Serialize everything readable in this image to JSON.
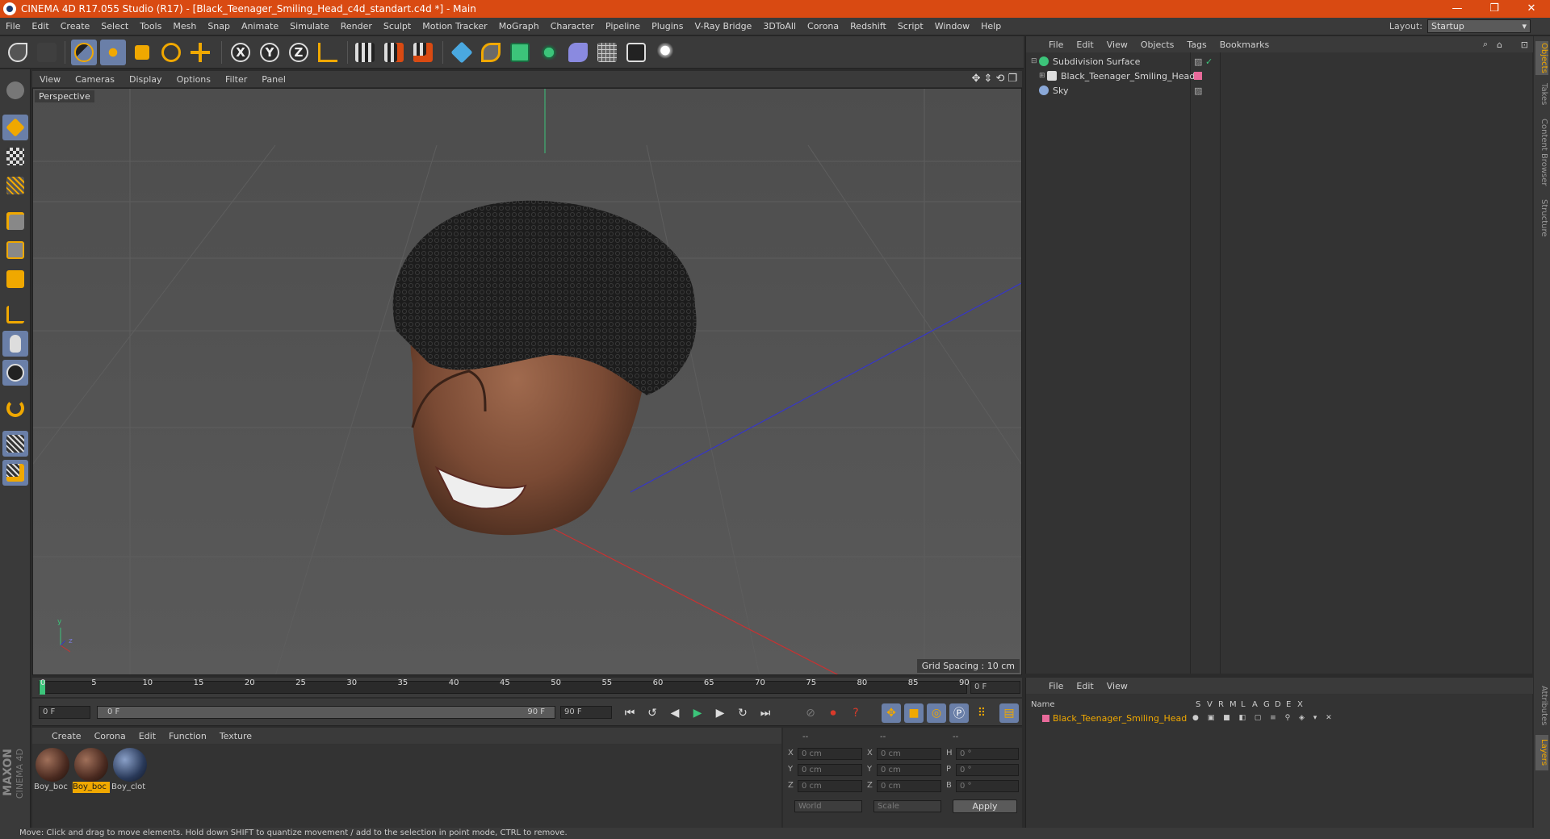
{
  "window": {
    "title": "CINEMA 4D R17.055 Studio (R17) - [Black_Teenager_Smiling_Head_c4d_standart.c4d *] - Main",
    "minimize": "—",
    "restore": "❐",
    "close": "✕"
  },
  "menubar": {
    "items": [
      "File",
      "Edit",
      "Create",
      "Select",
      "Tools",
      "Mesh",
      "Snap",
      "Animate",
      "Simulate",
      "Render",
      "Sculpt",
      "Motion Tracker",
      "MoGraph",
      "Character",
      "Pipeline",
      "Plugins",
      "V-Ray Bridge",
      "3DToAll",
      "Corona",
      "Redshift",
      "Script",
      "Window",
      "Help"
    ],
    "layout_label": "Layout:",
    "layout_value": "Startup"
  },
  "toolbar": {
    "axis_x": "X",
    "axis_y": "Y",
    "axis_z": "Z",
    "colors": {
      "active": "#6a7fa8",
      "orange": "#f0a800",
      "blue": "#4aa8e0",
      "green": "#3cc47a"
    }
  },
  "viewport": {
    "menu": [
      "View",
      "Cameras",
      "Display",
      "Options",
      "Filter",
      "Panel"
    ],
    "label": "Perspective",
    "grid_spacing": "Grid Spacing : 10 cm",
    "axis_y": "y",
    "axis_z": "z"
  },
  "timeline": {
    "ticks": [
      "0",
      "5",
      "10",
      "15",
      "20",
      "25",
      "30",
      "35",
      "40",
      "45",
      "50",
      "55",
      "60",
      "65",
      "70",
      "75",
      "80",
      "85",
      "90"
    ],
    "current_frame": "0 F",
    "start_field": "0 F",
    "range_start": "0 F",
    "range_end": "90 F",
    "end_field": "90 F"
  },
  "material_manager": {
    "menu": [
      "Create",
      "Corona",
      "Edit",
      "Function",
      "Texture"
    ],
    "materials": [
      {
        "label": "Boy_boc",
        "selected": false
      },
      {
        "label": "Boy_boc",
        "selected": true
      },
      {
        "label": "Boy_clot",
        "selected": false
      }
    ]
  },
  "coordinates": {
    "headers": [
      "--",
      "--",
      "--"
    ],
    "rows": [
      {
        "a": "X",
        "av": "0 cm",
        "b": "X",
        "bv": "0 cm",
        "c": "H",
        "cv": "0 °"
      },
      {
        "a": "Y",
        "av": "0 cm",
        "b": "Y",
        "bv": "0 cm",
        "c": "P",
        "cv": "0 °"
      },
      {
        "a": "Z",
        "av": "0 cm",
        "b": "Z",
        "bv": "0 cm",
        "c": "B",
        "cv": "0 °"
      }
    ],
    "mode1": "World",
    "mode2": "Scale",
    "apply": "Apply"
  },
  "object_manager": {
    "menu": [
      "File",
      "Edit",
      "View",
      "Objects",
      "Tags",
      "Bookmarks"
    ],
    "objects": [
      {
        "name": "Subdivision Surface",
        "icon": "subdivision-icon",
        "color": "#3cc47a",
        "depth": 0
      },
      {
        "name": "Black_Teenager_Smiling_Head",
        "icon": "null-object-icon",
        "color": "#ddd",
        "depth": 1
      },
      {
        "name": "Sky",
        "icon": "sky-icon",
        "color": "#8aa8d8",
        "depth": 0
      }
    ]
  },
  "layer_manager": {
    "menu": [
      "File",
      "Edit",
      "View"
    ],
    "columns": [
      "Name",
      "S",
      "V",
      "R",
      "M",
      "L",
      "A",
      "G",
      "D",
      "E",
      "X"
    ],
    "layers": [
      {
        "name": "Black_Teenager_Smiling_Head",
        "color": "#f0a800"
      }
    ]
  },
  "right_tabs": [
    "Objects",
    "Takes",
    "Content Browser",
    "Structure",
    "Attributes",
    "Layers"
  ],
  "status": "Move: Click and drag to move elements. Hold down SHIFT to quantize movement / add to the selection in point mode, CTRL to remove.",
  "branding": {
    "line1": "MAXON",
    "line2": "CINEMA 4D"
  }
}
